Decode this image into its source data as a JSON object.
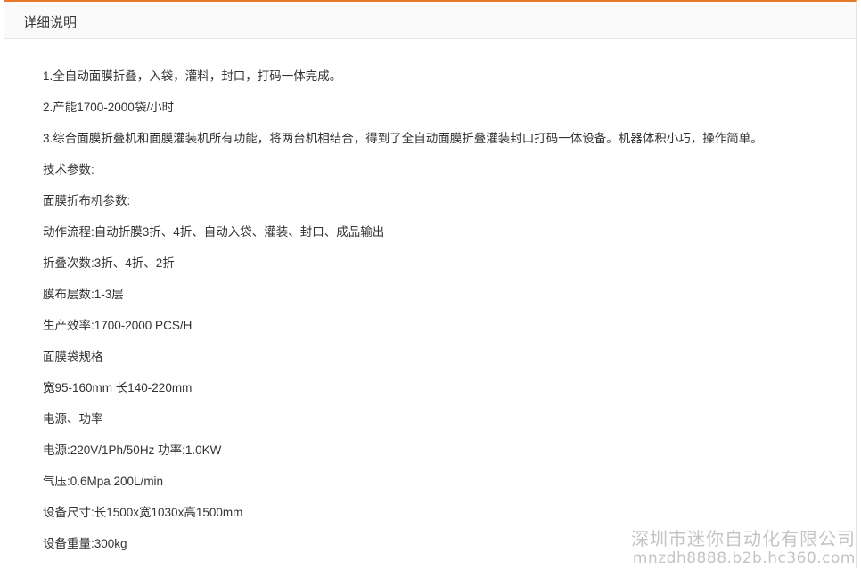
{
  "header": {
    "title": "详细说明"
  },
  "lines": [
    "1.全自动面膜折叠，入袋，灌料，封口，打码一体完成。",
    "2.产能1700-2000袋/小时",
    "3.综合面膜折叠机和面膜灌装机所有功能，将两台机相结合，得到了全自动面膜折叠灌装封口打码一体设备。机器体积小巧，操作简单。",
    "技术参数:",
    "面膜折布机参数:",
    "动作流程:自动折膜3折、4折、自动入袋、灌装、封口、成品输出",
    "折叠次数:3折、4折、2折",
    "膜布层数:1-3层",
    "生产效率:1700-2000 PCS/H",
    "面膜袋规格",
    "宽95-160mm 长140-220mm",
    "电源、功率",
    "电源:220V/1Ph/50Hz 功率:1.0KW",
    "气压:0.6Mpa 200L/min",
    "设备尺寸:长1500x宽1030x高1500mm",
    "设备重量:300kg"
  ],
  "watermark": {
    "company": "深圳市迷你自动化有限公司",
    "url": "mnzdh8888.b2b.hc360.com"
  },
  "colors": {
    "accent": "#e8782a",
    "text": "#333333",
    "watermark": "#c4c4c4"
  }
}
